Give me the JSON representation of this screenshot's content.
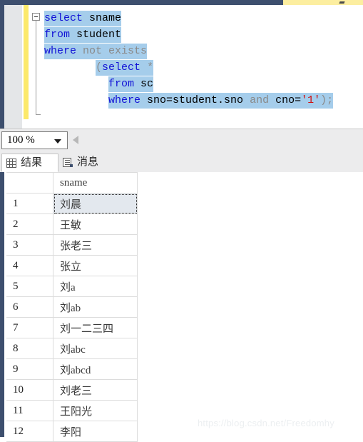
{
  "topbar": {
    "tab_glyph_icon": "tab-edge-glyph"
  },
  "editor": {
    "collapse_icon": "collapse-minus-icon",
    "lines": [
      {
        "indent": 0,
        "tokens": [
          {
            "t": "select",
            "k": "kw"
          },
          {
            "t": " sname",
            "k": "pl"
          }
        ]
      },
      {
        "indent": 0,
        "tokens": [
          {
            "t": "from",
            "k": "kw"
          },
          {
            "t": " student",
            "k": "pl"
          }
        ]
      },
      {
        "indent": 0,
        "tokens": [
          {
            "t": "where",
            "k": "kw"
          },
          {
            "t": " ",
            "k": "pl"
          },
          {
            "t": "not exists",
            "k": "gy"
          }
        ]
      },
      {
        "indent": 4,
        "tokens": [
          {
            "t": "(",
            "k": "gy"
          },
          {
            "t": "select",
            "k": "kw"
          },
          {
            "t": " ",
            "k": "pl"
          },
          {
            "t": "*",
            "k": "gy"
          }
        ]
      },
      {
        "indent": 5,
        "tokens": [
          {
            "t": "from",
            "k": "kw"
          },
          {
            "t": " sc",
            "k": "pl"
          }
        ]
      },
      {
        "indent": 5,
        "tokens": [
          {
            "t": "where",
            "k": "kw"
          },
          {
            "t": " sno=student.sno ",
            "k": "pl"
          },
          {
            "t": "and",
            "k": "gy"
          },
          {
            "t": " cno=",
            "k": "pl"
          },
          {
            "t": "'1'",
            "k": "str"
          },
          {
            "t": ");",
            "k": "gy"
          }
        ]
      }
    ],
    "full_sql": "select sname\nfrom student\nwhere not exists\n    (select *\n     from sc\n     where sno=student.sno and cno='1');"
  },
  "zoombar": {
    "zoom_value": "100 %",
    "dropdown_icon": "chevron-down-icon",
    "nav_back_icon": "triangle-left-icon"
  },
  "tabs": [
    {
      "id": "results",
      "label": "结果",
      "icon": "grid-icon",
      "active": true
    },
    {
      "id": "messages",
      "label": "消息",
      "icon": "message-icon",
      "active": false
    }
  ],
  "grid": {
    "columns": [
      "",
      "sname"
    ],
    "selected_row": 1,
    "rows": [
      {
        "num": "1",
        "sname": "刘晨"
      },
      {
        "num": "2",
        "sname": "王敏"
      },
      {
        "num": "3",
        "sname": "张老三"
      },
      {
        "num": "4",
        "sname": "张立"
      },
      {
        "num": "5",
        "sname": "刘a"
      },
      {
        "num": "6",
        "sname": "刘ab"
      },
      {
        "num": "7",
        "sname": "刘一二三四"
      },
      {
        "num": "8",
        "sname": "刘abc"
      },
      {
        "num": "9",
        "sname": "刘abcd"
      },
      {
        "num": "10",
        "sname": "刘老三"
      },
      {
        "num": "11",
        "sname": "王阳光"
      },
      {
        "num": "12",
        "sname": "李阳"
      }
    ]
  },
  "watermark": {
    "text": "https://blog.csdn.net/Freedomhy"
  },
  "colors": {
    "chrome_navy": "#3d4f6e",
    "change_bar_yellow": "#fce96a",
    "tabstrip_yellow": "#fceea0",
    "selection_blue": "#a5cdeb",
    "keyword_blue": "#1212d6",
    "comment_gray": "#8a8a8a",
    "string_red": "#d01010",
    "grid_line": "#dcdcdc",
    "selected_cell": "#e3e8ee"
  }
}
